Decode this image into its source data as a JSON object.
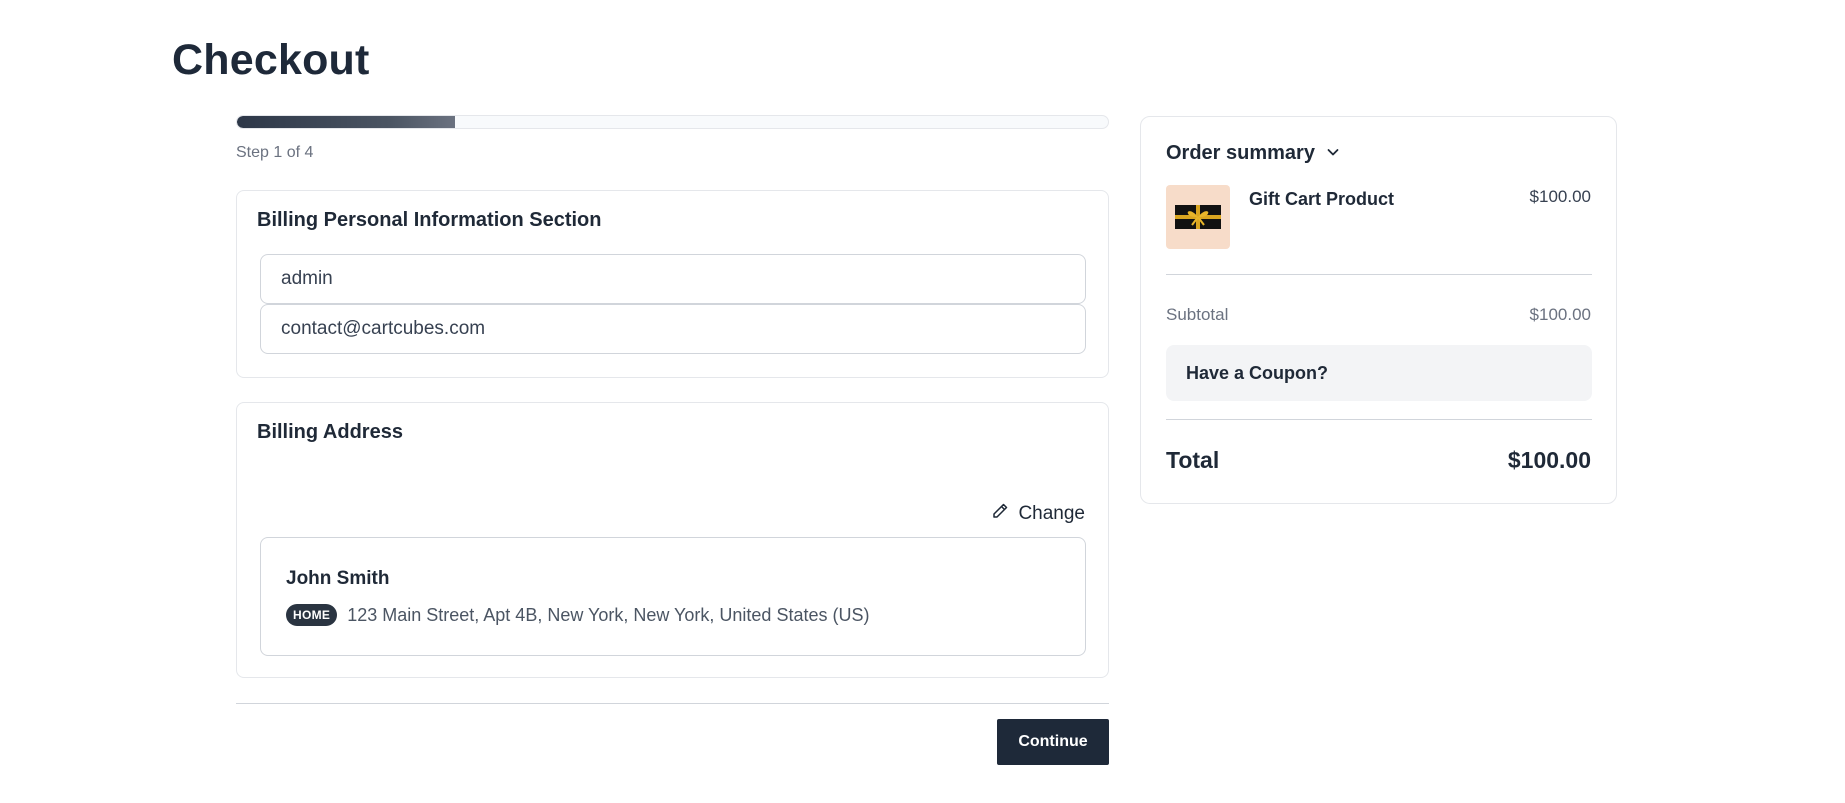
{
  "page": {
    "title": "Checkout"
  },
  "progress": {
    "step_text": "Step 1 of 4",
    "fraction": 0.25
  },
  "personal": {
    "title": "Billing Personal Information Section",
    "name_value": "admin",
    "email_value": "contact@cartcubes.com"
  },
  "address": {
    "title": "Billing Address",
    "change_label": "Change",
    "name": "John Smith",
    "badge": "HOME",
    "line": "123 Main Street, Apt 4B, New York, New York, United States (US)"
  },
  "actions": {
    "continue_label": "Continue"
  },
  "summary": {
    "title": "Order summary",
    "product": {
      "name": "Gift Cart Product",
      "price": "$100.00",
      "icon": "gift-card-icon"
    },
    "subtotal_label": "Subtotal",
    "subtotal_value": "$100.00",
    "coupon_label": "Have a Coupon?",
    "total_label": "Total",
    "total_value": "$100.00"
  },
  "colors": {
    "primary": "#1e2939",
    "badge": "#2a3441",
    "thumb_bg": "#f7dcc9"
  }
}
